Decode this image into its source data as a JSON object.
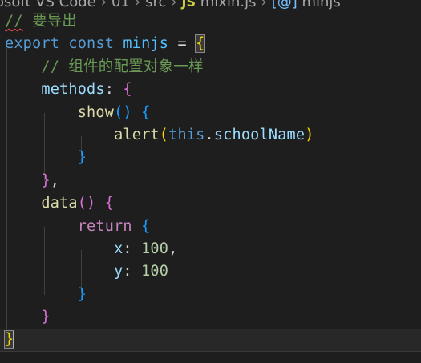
{
  "breadcrumb": {
    "items": [
      "osoft VS Code",
      "01",
      "src"
    ],
    "file_badge": "JS",
    "file_name": "mixin.js",
    "symbol_badge": "[@]",
    "symbol_name": "minjs"
  },
  "code": {
    "comment1_slashes": "//",
    "comment1_text": " 要导出",
    "export_kw": "export",
    "const_kw": "const",
    "var_name": "minjs",
    "eq": " = ",
    "open_brace": "{",
    "comment2": "// 组件的配置对象一样",
    "methods_key": "methods",
    "colon": ": ",
    "show_fn": "show",
    "parens": "()",
    "alert_fn": "alert",
    "this_kw": "this",
    "dot": ".",
    "prop_school": "schoolName",
    "close_brace": "}",
    "close_brace_comma": "},",
    "data_fn": "data",
    "return_kw": "return",
    "x_key": "x",
    "x_val": "100",
    "comma": ",",
    "y_key": "y",
    "y_val": "100"
  },
  "colors": {
    "background": "#1e1e1e",
    "keyword": "#569cd6",
    "control": "#c586c0",
    "function": "#dcdcaa",
    "property": "#9cdcfe",
    "number": "#b5cea8",
    "comment": "#6a9955",
    "bracket_level1": "#ffd700",
    "bracket_level2": "#da70d6",
    "bracket_level3": "#179fff"
  }
}
